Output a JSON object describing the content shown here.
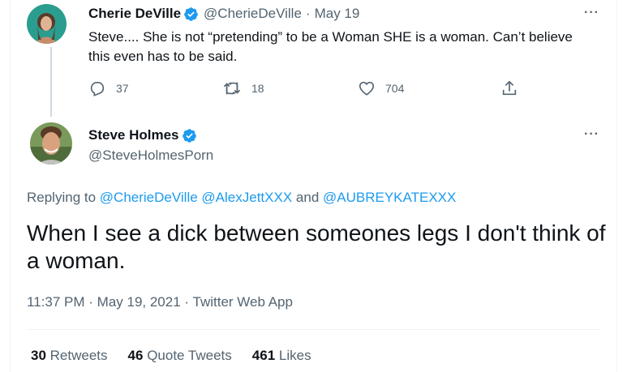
{
  "parent_tweet": {
    "display_name": "Cherie DeVille",
    "handle": "@CherieDeVille",
    "separator": "·",
    "date": "May 19",
    "text": "Steve.... She is not “pretending” to be a Woman SHE is a woman.  Can’t believe this even has to be said.",
    "more_label": "···",
    "replies": "37",
    "retweets": "18",
    "likes": "704"
  },
  "reply_tweet": {
    "display_name": "Steve Holmes",
    "handle": "@SteveHolmesPorn",
    "more_label": "···",
    "replying_prefix": "Replying to",
    "mention_1": "@CherieDeVille",
    "mention_2": "@AlexJettXXX",
    "and_text": "and",
    "mention_3": "@AUBREYKATEXXX",
    "text": "When I see a dick between someones legs I don't think of a woman.",
    "time": "11:37 PM",
    "meta_sep_1": "·",
    "date": "May 19, 2021",
    "meta_sep_2": "·",
    "source": "Twitter Web App",
    "stats": {
      "retweets_count": "30",
      "retweets_label": "Retweets",
      "quotes_count": "46",
      "quotes_label": "Quote Tweets",
      "likes_count": "461",
      "likes_label": "Likes"
    }
  },
  "colors": {
    "accent": "#1d9bf0",
    "muted": "#536471",
    "text": "#0f1419",
    "border": "#eff3f4"
  },
  "icons": [
    "verified-badge-icon",
    "more-icon",
    "reply-icon",
    "retweet-icon",
    "like-icon",
    "share-icon"
  ]
}
